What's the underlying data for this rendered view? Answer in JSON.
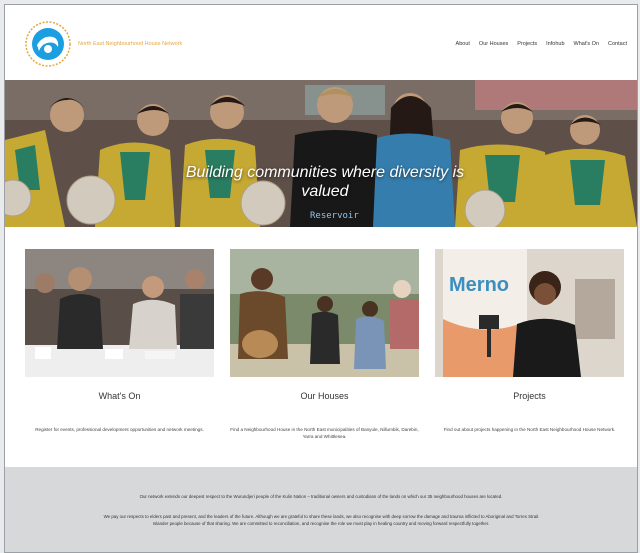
{
  "header": {
    "site_name": "North East Neighbourhood House Network",
    "nav": [
      "About",
      "Our Houses",
      "Projects",
      "Infohub",
      "What's On",
      "Contact"
    ]
  },
  "hero": {
    "headline": "Building communities where diversity is valued",
    "sign_text": "Reservoir"
  },
  "cards": [
    {
      "title": "What's On",
      "text": "Register for events, professional development opportunities and network meetings."
    },
    {
      "title": "Our Houses",
      "text": "Find a Neighbourhood House in the North East municipalities of Banyule, Nillumbik, Darebin, Yarra and Whittlesea."
    },
    {
      "title": "Projects",
      "text": "Find out about projects happening in the North East Neighbourhood House Network.",
      "banner_text": "Merno"
    }
  ],
  "footer": {
    "para1": "Our network extends our deepest respect to the Wurundjeri people of the Kulin Nation – traditional owners and custodians of the lands on which our 35 neighbourhood houses are located.",
    "para2": "We pay our respects to elders past and present, and the leaders of the future. Although we are grateful to share these lands, we also recognise with deep sorrow the damage and trauma inflicted to Aboriginal and Torres Strait Islander people because of that sharing. We are committed to reconciliation, and recognise the role we must play in healing country and moving forward respectfully together."
  },
  "colors": {
    "accent": "#e8a640",
    "logo_blue": "#1d9ee0",
    "footer_bg": "#d7d8da",
    "text": "#333333"
  }
}
